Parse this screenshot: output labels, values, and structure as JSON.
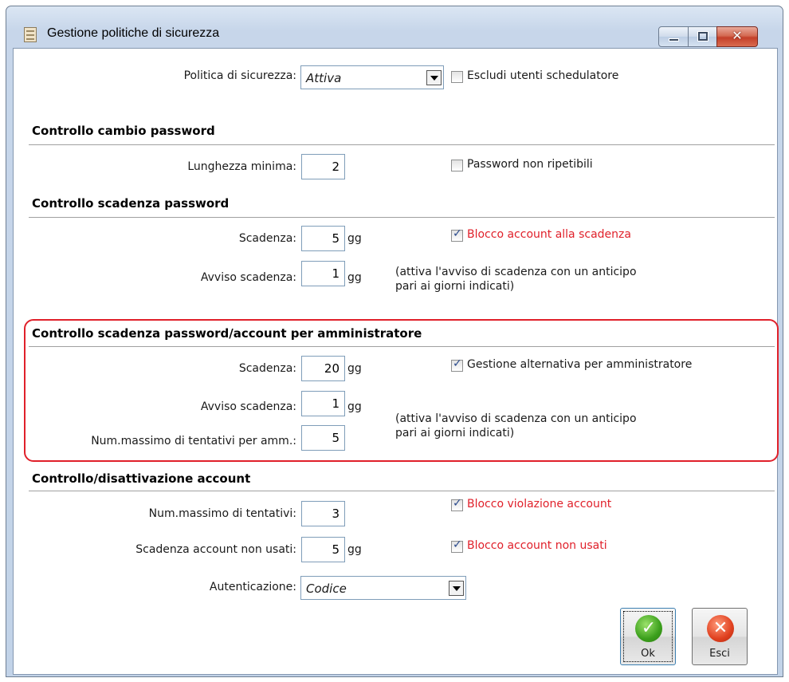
{
  "window": {
    "title": "Gestione politiche di sicurezza"
  },
  "policy": {
    "label": "Politica di sicurezza:",
    "value": "Attiva",
    "exclude_label": "Escludi utenti schedulatore",
    "exclude_checked": false
  },
  "pwd_change": {
    "heading": "Controllo cambio password",
    "min_length_label": "Lunghezza minima:",
    "min_length": "2",
    "non_repeat_label": "Password non ripetibili",
    "non_repeat_checked": false
  },
  "pwd_expiry": {
    "heading": "Controllo scadenza password",
    "expiry_label": "Scadenza:",
    "expiry": "5",
    "expiry_unit": "gg",
    "block_label": "Blocco account alla scadenza",
    "block_checked": true,
    "warn_label": "Avviso scadenza:",
    "warn": "1",
    "warn_unit": "gg",
    "note_line1": "(attiva l'avviso di scadenza con un anticipo",
    "note_line2": "pari ai giorni indicati)"
  },
  "admin": {
    "heading": "Controllo scadenza password/account per amministratore",
    "expiry_label": "Scadenza:",
    "expiry": "20",
    "expiry_unit": "gg",
    "alt_label": "Gestione alternativa per amministratore",
    "alt_checked": true,
    "warn_label": "Avviso scadenza:",
    "warn": "1",
    "warn_unit": "gg",
    "attempts_label": "Num.massimo di tentativi per amm.:",
    "attempts": "5",
    "note_line1": "(attiva l'avviso di scadenza con un anticipo",
    "note_line2": "pari ai giorni indicati)"
  },
  "account": {
    "heading": "Controllo/disattivazione account",
    "attempts_label": "Num.massimo di tentativi:",
    "attempts": "3",
    "violation_label": "Blocco violazione account",
    "violation_checked": true,
    "unused_label": "Scadenza account non usati:",
    "unused": "5",
    "unused_unit": "gg",
    "unused_block_label": "Blocco account non usati",
    "unused_block_checked": true,
    "auth_label": "Autenticazione:",
    "auth_value": "Codice"
  },
  "buttons": {
    "ok_label": "Ok",
    "exit_label": "Esci"
  },
  "colors": {
    "warning_text": "#e0202a",
    "highlight_border": "#e0202a"
  }
}
